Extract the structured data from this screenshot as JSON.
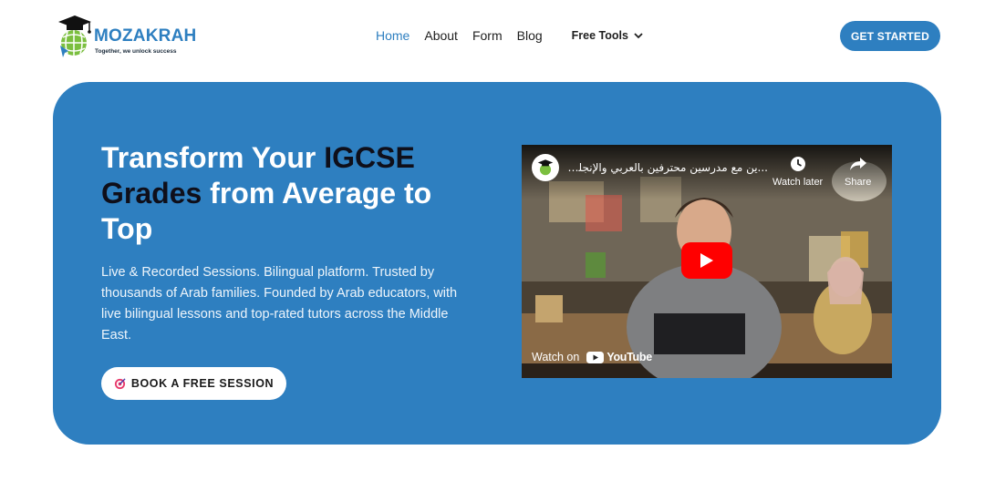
{
  "brand": {
    "name": "MOZAKRAH",
    "tagline": "Together, we unlock success"
  },
  "nav": {
    "items": [
      {
        "label": "Home",
        "active": true
      },
      {
        "label": "About"
      },
      {
        "label": "Form"
      },
      {
        "label": "Blog"
      }
    ],
    "tools_label": "Free Tools"
  },
  "header": {
    "cta_label": "GET STARTED"
  },
  "hero": {
    "title_part1": "Transform Your ",
    "title_highlight1": "IGCSE",
    "title_highlight2": "Grades",
    "title_part2": " from Average to Top",
    "description": "Live & Recorded Sessions. Bilingual platform. Trusted by thousands of Arab families. Founded by Arab educators, with live bilingual lessons and top-rated tutors across the Middle East.",
    "button_label": "BOOK A FREE SESSION"
  },
  "video": {
    "title": "...ين مع مدرسين محترفين بالعربي والإنجليزي",
    "watch_later": "Watch later",
    "share": "Share",
    "watch_on": "Watch on",
    "youtube": "YouTube"
  },
  "colors": {
    "primary": "#2e7fc0",
    "dark_text": "#0f0f1a",
    "youtube_red": "#ff0000"
  }
}
